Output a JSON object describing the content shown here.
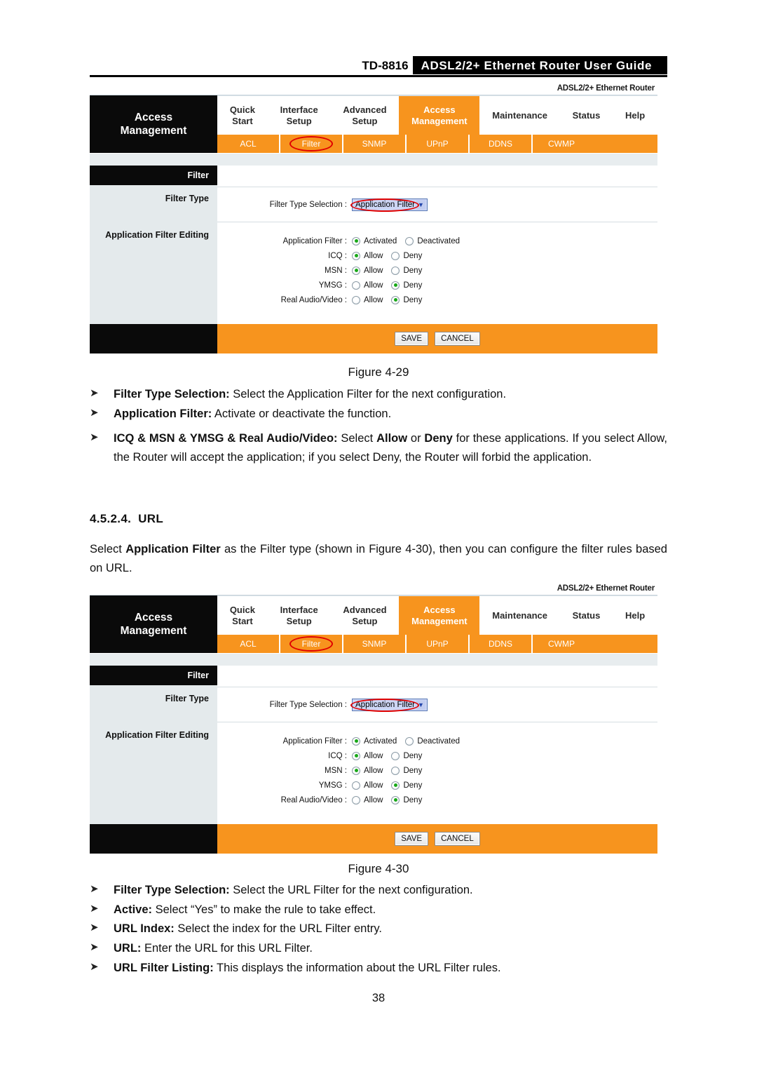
{
  "header": {
    "model": "TD-8816",
    "title": "ADSL2/2+ Ethernet Router User Guide"
  },
  "router_ui": {
    "brand_label": "ADSL2/2+ Ethernet Router",
    "sidebar_title_line1": "Access",
    "sidebar_title_line2": "Management",
    "main_tabs": [
      {
        "line1": "Quick",
        "line2": "Start",
        "active": false
      },
      {
        "line1": "Interface",
        "line2": "Setup",
        "active": false
      },
      {
        "line1": "Advanced",
        "line2": "Setup",
        "active": false
      },
      {
        "line1": "Access",
        "line2": "Management",
        "active": true
      },
      {
        "line1": "Maintenance",
        "line2": "",
        "active": false
      },
      {
        "line1": "Status",
        "line2": "",
        "active": false
      },
      {
        "line1": "Help",
        "line2": "",
        "active": false
      }
    ],
    "sub_tabs": [
      {
        "label": "ACL",
        "highlighted": false
      },
      {
        "label": "Filter",
        "highlighted": true
      },
      {
        "label": "SNMP",
        "highlighted": false
      },
      {
        "label": "UPnP",
        "highlighted": false
      },
      {
        "label": "DDNS",
        "highlighted": false
      },
      {
        "label": "CWMP",
        "highlighted": false
      }
    ],
    "panel_title": "Filter",
    "panel_section_1": "Filter Type",
    "panel_section_2": "Application Filter Editing",
    "filter_type_selection_label": "Filter Type Selection :",
    "filter_type_selection_value": "Application Filter",
    "rows": [
      {
        "label": "Application Filter :",
        "opt1": "Activated",
        "opt2": "Deactivated",
        "selected": 1
      },
      {
        "label": "ICQ :",
        "opt1": "Allow",
        "opt2": "Deny",
        "selected": 1
      },
      {
        "label": "MSN :",
        "opt1": "Allow",
        "opt2": "Deny",
        "selected": 1
      },
      {
        "label": "YMSG :",
        "opt1": "Allow",
        "opt2": "Deny",
        "selected": 2
      },
      {
        "label": "Real Audio/Video :",
        "opt1": "Allow",
        "opt2": "Deny",
        "selected": 2
      }
    ],
    "save_label": "SAVE",
    "cancel_label": "CANCEL",
    "accent_color": "#F7941E",
    "annotation_color": "#E00000"
  },
  "figure_29": {
    "caption": "Figure 4-29"
  },
  "figure_30": {
    "caption": "Figure 4-30"
  },
  "bullets_29": [
    {
      "marker": "➤",
      "bold": "Filter Type Selection:",
      "text": " Select the Application Filter for the next configuration."
    },
    {
      "marker": "➤",
      "bold": "Application Filter:",
      "text": " Activate or deactivate the function."
    }
  ],
  "bullet_29_long": {
    "marker": "➤",
    "bold": "ICQ & MSN & YMSG & Real Audio/Video:",
    "text_1": " Select ",
    "bold_2": "Allow",
    "text_2": " or ",
    "bold_3": "Deny",
    "text_3": " for these applications. If you select Allow, the Router will accept the application; if you select Deny, the Router will forbid the application."
  },
  "section": {
    "number": "4.5.2.4.",
    "title": "URL"
  },
  "intro_paragraph": {
    "text_1": "Select ",
    "bold_1": "Application Filter",
    "text_2": " as the Filter type (shown in Figure 4-30), then you can configure the filter rules based on URL."
  },
  "bullets_30": [
    {
      "marker": "➤",
      "bold": "Filter Type Selection:",
      "text": " Select the URL Filter for the next configuration."
    },
    {
      "marker": "➤",
      "bold": "Active:",
      "text": " Select “Yes” to make the rule to take effect."
    },
    {
      "marker": "➤",
      "bold": "URL Index:",
      "text": " Select the index for the URL Filter entry."
    },
    {
      "marker": "➤",
      "bold": "URL:",
      "text": " Enter the URL for this URL Filter."
    },
    {
      "marker": "➤",
      "bold": "URL Filter Listing:",
      "text": " This displays the information about the URL Filter rules."
    }
  ],
  "page_number": "38"
}
